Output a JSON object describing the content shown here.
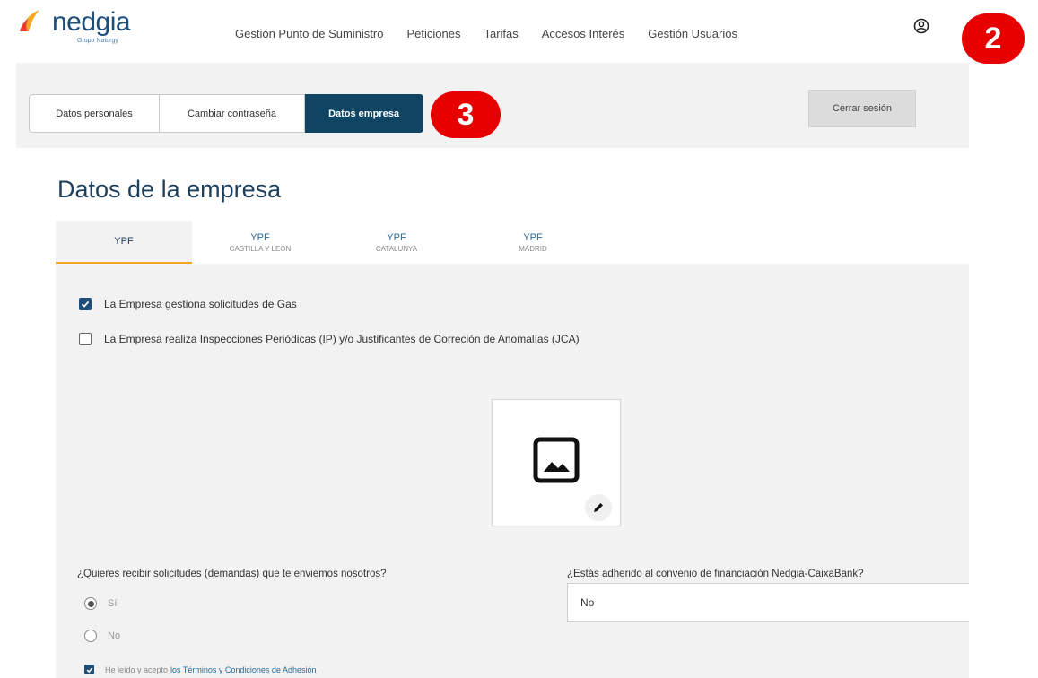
{
  "header": {
    "brand": "nedgia",
    "brand_sub": "Grupo Naturgy",
    "nav": [
      "Gestión Punto de Suministro",
      "Peticiones",
      "Tarifas",
      "Accesos Interés",
      "Gestión Usuarios"
    ],
    "user_icon": "user-circle-icon"
  },
  "badges": {
    "two": "2",
    "three": "3"
  },
  "account_tabs": [
    "Datos personales",
    "Cambiar contraseña",
    "Datos empresa"
  ],
  "logout_label": "Cerrar sesión",
  "page_title": "Datos de la empresa",
  "company_tabs": [
    {
      "name": "YPF",
      "region": ""
    },
    {
      "name": "YPF",
      "region": "CASTILLA Y LEON"
    },
    {
      "name": "YPF",
      "region": "CATALUNYA"
    },
    {
      "name": "YPF",
      "region": "MADRID"
    }
  ],
  "checkboxes": [
    {
      "label": "La Empresa gestiona solicitudes de Gas",
      "checked": true
    },
    {
      "label": "La Empresa realiza Inspecciones Periódicas (IP) y/o Justificantes de Correción de Anomalías (JCA)",
      "checked": false
    }
  ],
  "question_left": "¿Quieres recibir solicitudes (demandas) que te enviemos nosotros?",
  "radio_options": [
    {
      "label": "Sí",
      "selected": true
    },
    {
      "label": "No",
      "selected": false
    }
  ],
  "question_right": "¿Estás adherido al convenio de financiación Nedgia-CaixaBank?",
  "financing_value": "No",
  "terms": {
    "prefix": "He leído y acepto",
    "link": "los Términos y Condiciones de Adhesión",
    "checked": true
  },
  "colors": {
    "primary": "#0f4563",
    "accent": "#f5a623",
    "badge": "#e60000"
  }
}
